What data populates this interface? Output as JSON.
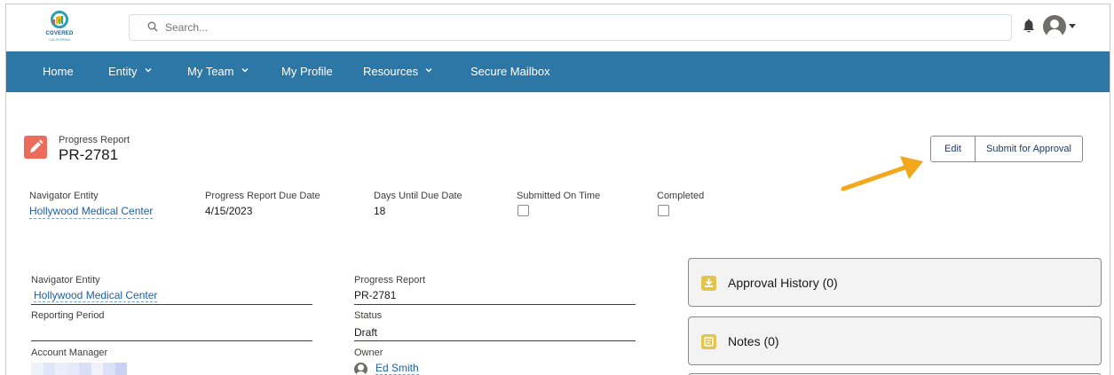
{
  "header": {
    "logo_text": "COVERED",
    "logo_subtext": "CALIFORNIA",
    "search_placeholder": "Search..."
  },
  "nav": {
    "items": [
      {
        "label": "Home"
      },
      {
        "label": "Entity"
      },
      {
        "label": "My Team"
      },
      {
        "label": "My Profile"
      },
      {
        "label": "Resources"
      },
      {
        "label": "Secure Mailbox"
      }
    ]
  },
  "record": {
    "type_label": "Progress Report",
    "name": "PR-2781",
    "actions": {
      "edit": "Edit",
      "submit": "Submit for Approval"
    }
  },
  "highlights": {
    "navigator_entity_label": "Navigator Entity",
    "navigator_entity_value": "Hollywood Medical Center",
    "due_date_label": "Progress Report Due Date",
    "due_date_value": "4/15/2023",
    "days_until_label": "Days Until Due Date",
    "days_until_value": "18",
    "submitted_on_time_label": "Submitted On Time",
    "submitted_on_time_checked": false,
    "completed_label": "Completed",
    "completed_checked": false
  },
  "details": {
    "navigator_entity_label": "Navigator Entity",
    "navigator_entity_value": "Hollywood Medical Center",
    "progress_report_label": "Progress Report",
    "progress_report_value": "PR-2781",
    "reporting_period_label": "Reporting Period",
    "reporting_period_value": "",
    "status_label": "Status",
    "status_value": "Draft",
    "account_manager_label": "Account Manager",
    "owner_label": "Owner",
    "owner_value": "Ed Smith"
  },
  "related": {
    "approval_history": "Approval History (0)",
    "notes": "Notes (0)"
  },
  "colors": {
    "nav_bg": "#2d77a6",
    "record_icon": "#ec6b5a",
    "card_icon": "#e3c44d",
    "link": "#1c5fa8",
    "annotation_arrow": "#f2a81d"
  }
}
